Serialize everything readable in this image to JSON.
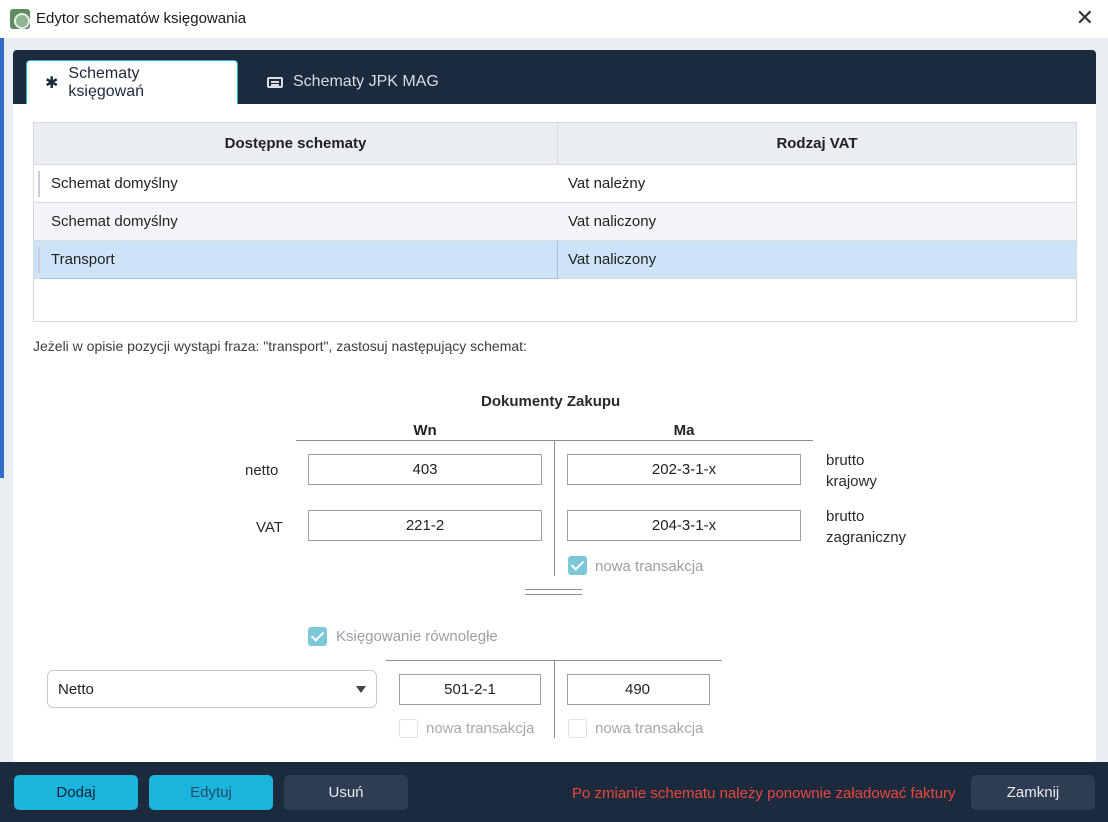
{
  "window": {
    "title": "Edytor schematów księgowania"
  },
  "tabs": [
    {
      "label": "Schematy księgowań",
      "icon": "asterisk-icon",
      "active": true
    },
    {
      "label": "Schematy JPK MAG",
      "icon": "keyboard-icon",
      "active": false
    }
  ],
  "grid": {
    "columns": [
      "Dostępne schematy",
      "Rodzaj VAT"
    ],
    "rows": [
      {
        "name": "Schemat domyślny",
        "vat": "Vat należny"
      },
      {
        "name": "Schemat domyślny",
        "vat": "Vat naliczony"
      },
      {
        "name": "Transport",
        "vat": "Vat naliczony",
        "selected": true
      }
    ]
  },
  "info_text": "Jeżeli w opisie pozycji wystąpi fraza: \"transport\", zastosuj następujący schemat:",
  "documents": {
    "title": "Dokumenty Zakupu",
    "col_wn": "Wn",
    "col_ma": "Ma",
    "rows": [
      {
        "label": "netto",
        "wn": "403",
        "ma": "202-3-1-x",
        "right_label_1": "brutto",
        "right_label_2": "krajowy"
      },
      {
        "label": "VAT",
        "wn": "221-2",
        "ma": "204-3-1-x",
        "right_label_1": "brutto",
        "right_label_2": "zagraniczny"
      }
    ],
    "new_transaction_label": "nowa transakcja",
    "new_transaction_checked": true
  },
  "parallel": {
    "label": "Księgowanie równoległe",
    "checked": true,
    "dropdown_value": "Netto",
    "wn": "501-2-1",
    "ma": "490",
    "wn_new_transaction": "nowa transakcja",
    "ma_new_transaction": "nowa transakcja"
  },
  "footer": {
    "add_label": "Dodaj",
    "edit_label": "Edytuj",
    "delete_label": "Usuń",
    "message": "Po zmianie schematu należy ponownie załadować faktury",
    "close_label": "Zamknij"
  },
  "colors": {
    "accent": "#1ab4dc",
    "header_dark": "#1c2a3d",
    "warning_text": "#e8463c",
    "selection": "#cde4f8"
  }
}
